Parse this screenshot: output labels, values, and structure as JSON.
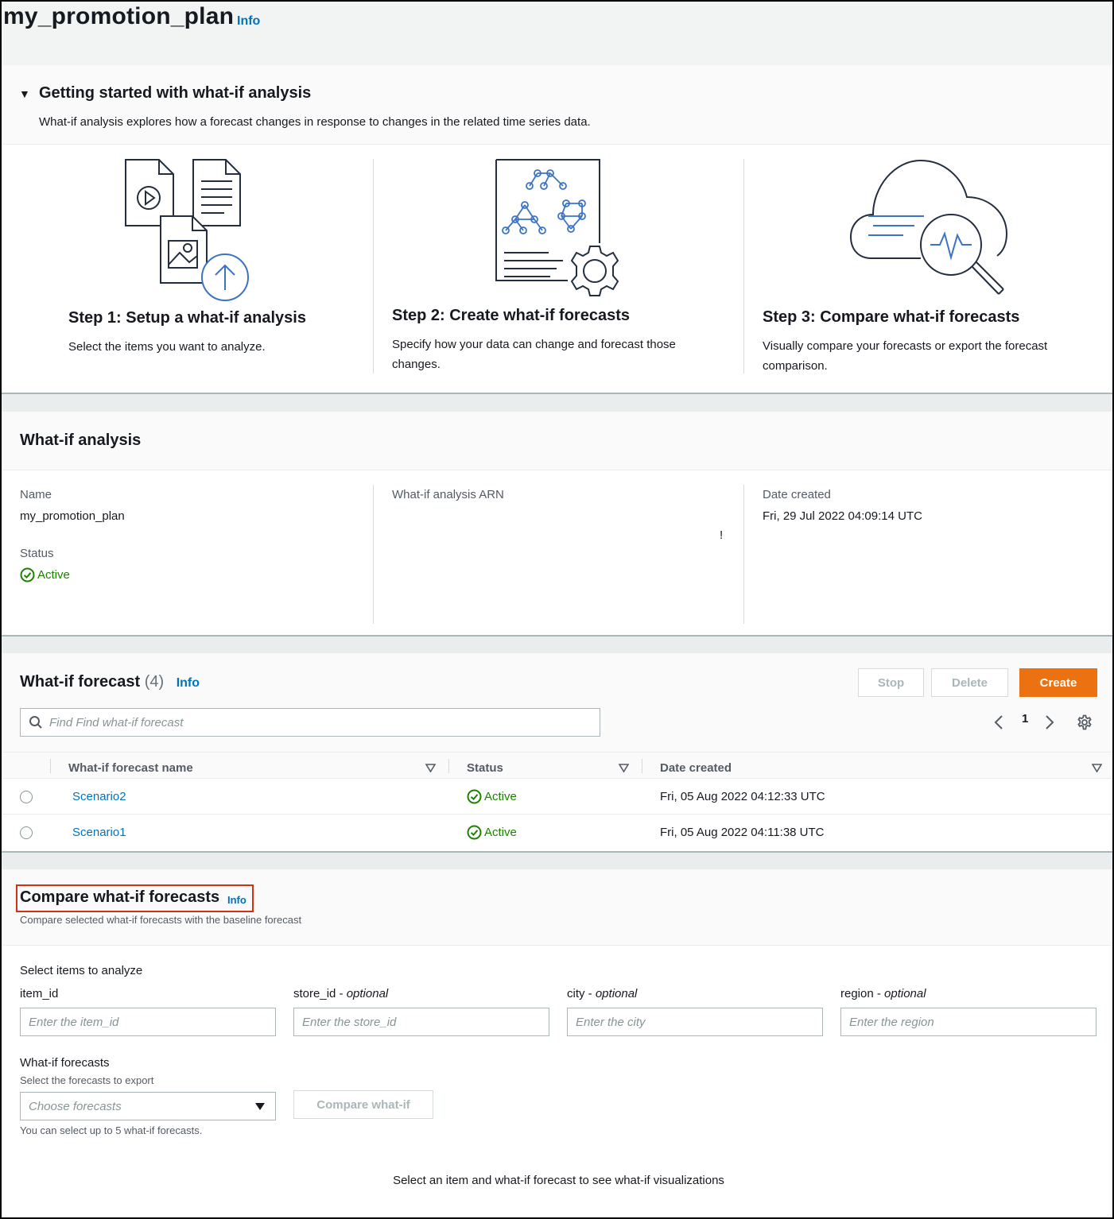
{
  "page": {
    "title": "my_promotion_plan",
    "info": "Info"
  },
  "getting_started": {
    "toggle": "▼",
    "title": "Getting started with what-if analysis",
    "description": "What-if analysis explores how a forecast changes in response to changes in the related time series data.",
    "steps": [
      {
        "title": "Step 1: Setup a what-if analysis",
        "description": "Select the items you want to analyze."
      },
      {
        "title": "Step 2: Create what-if forecasts",
        "description": "Specify how your data can change and forecast those changes."
      },
      {
        "title": "Step 3: Compare what-if forecasts",
        "description": "Visually compare your forecasts or export the forecast comparison."
      }
    ]
  },
  "analysis": {
    "title": "What-if analysis",
    "name_label": "Name",
    "name_value": "my_promotion_plan",
    "status_label": "Status",
    "status_value": "Active",
    "arn_label": "What-if analysis ARN",
    "arn_value": "!",
    "date_label": "Date created",
    "date_value": "Fri, 29 Jul 2022 04:09:14 UTC"
  },
  "forecast": {
    "title": "What-if forecast",
    "count": "(4)",
    "info": "Info",
    "buttons": {
      "stop": "Stop",
      "delete": "Delete",
      "create": "Create"
    },
    "search_placeholder": "Find Find what-if forecast",
    "page_number": "1",
    "columns": [
      "What-if forecast name",
      "Status",
      "Date created"
    ],
    "rows": [
      {
        "name": "Scenario2",
        "status": "Active",
        "date": "Fri, 05 Aug 2022 04:12:33 UTC"
      },
      {
        "name": "Scenario1",
        "status": "Active",
        "date": "Fri, 05 Aug 2022 04:11:38 UTC"
      }
    ]
  },
  "compare": {
    "title": "Compare what-if forecasts",
    "info": "Info",
    "description": "Compare selected what-if forecasts with the baseline forecast",
    "select_items_label": "Select items to analyze",
    "fields": [
      {
        "label": "item_id",
        "optional": "",
        "placeholder": "Enter the item_id"
      },
      {
        "label": "store_id - ",
        "optional": "optional",
        "placeholder": "Enter the store_id"
      },
      {
        "label": "city - ",
        "optional": "optional",
        "placeholder": "Enter the city"
      },
      {
        "label": "region - ",
        "optional": "optional",
        "placeholder": "Enter the region"
      }
    ],
    "forecasts_label": "What-if forecasts",
    "forecasts_sublabel": "Select the forecasts to export",
    "forecasts_placeholder": "Choose forecasts",
    "compare_button": "Compare what-if",
    "limit_hint": "You can select up to 5 what-if forecasts.",
    "empty_message": "Select an item and what-if forecast to see what-if visualizations"
  },
  "colors": {
    "accent": "#ec7211",
    "link": "#0073bb",
    "success": "#1d8102",
    "highlight_border": "#d13212"
  }
}
